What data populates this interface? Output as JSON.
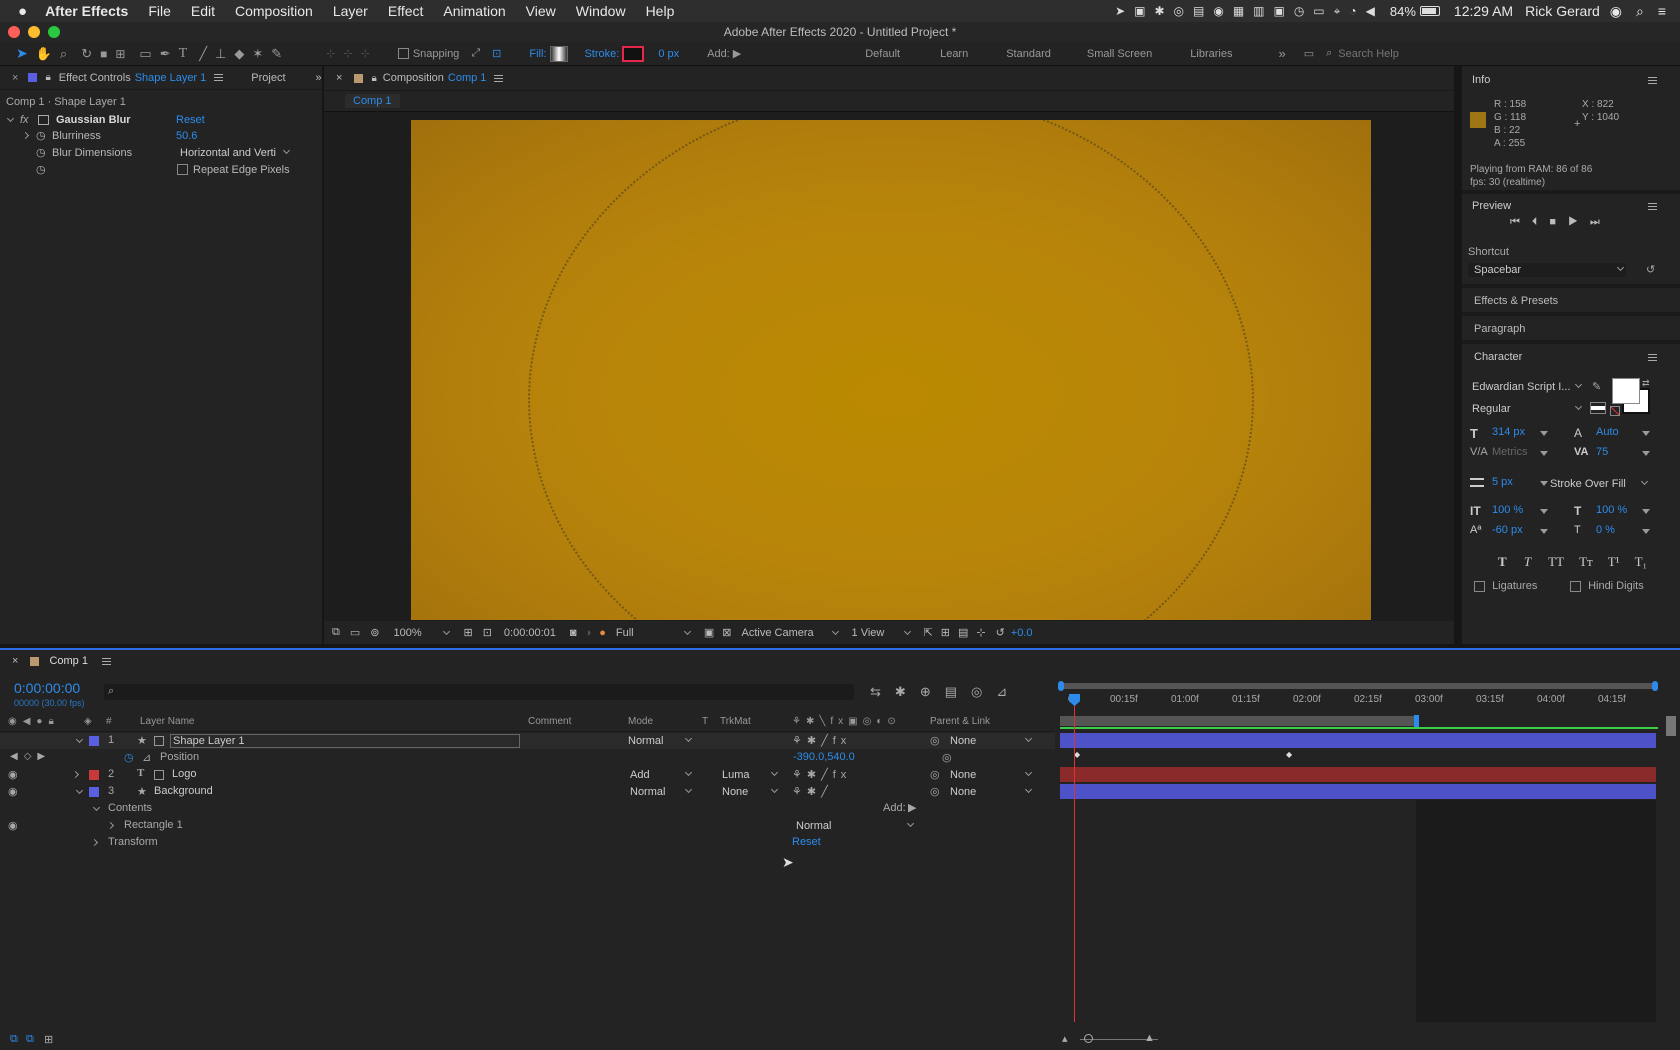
{
  "menubar": {
    "app": "After Effects",
    "items": [
      "File",
      "Edit",
      "Composition",
      "Layer",
      "Effect",
      "Animation",
      "View",
      "Window",
      "Help"
    ],
    "battery": "84%",
    "time": "12:29 AM",
    "user": "Rick Gerard"
  },
  "titlebar": {
    "title": "Adobe After Effects 2020 - Untitled Project *"
  },
  "toolbar": {
    "snapping": "Snapping",
    "fill": "Fill:",
    "stroke": "Stroke:",
    "stroke_px": "0 px",
    "add": "Add:",
    "workspaces": [
      "Default",
      "Learn",
      "Standard",
      "Small Screen",
      "Libraries"
    ],
    "search_placeholder": "Search Help"
  },
  "effect_controls": {
    "tab_prefix": "Effect Controls",
    "tab_layer": "Shape Layer 1",
    "project_tab": "Project",
    "breadcrumb": "Comp 1 · Shape Layer 1",
    "effect_name": "Gaussian Blur",
    "reset": "Reset",
    "blurriness_label": "Blurriness",
    "blurriness_value": "50.6",
    "dimensions_label": "Blur Dimensions",
    "dimensions_value": "Horizontal and Verti",
    "repeat_edge": "Repeat Edge Pixels"
  },
  "composition": {
    "tab_prefix": "Composition",
    "tab_comp": "Comp 1",
    "breadcrumb_comp": "Comp 1",
    "canvas_color": "#B8820E",
    "zoom": "100%",
    "timecode": "0:00:00:01",
    "resolution": "Full",
    "camera": "Active Camera",
    "views": "1 View",
    "exposure": "+0.0"
  },
  "info": {
    "title": "Info",
    "r": "R : 158",
    "g": "G : 118",
    "b": "B : 22",
    "a": "A : 255",
    "x": "X : 822",
    "y": "Y : 1040",
    "playing": "Playing from RAM: 86 of 86",
    "fps": "fps: 30 (realtime)",
    "swatch_color": "#9E7616"
  },
  "preview": {
    "title": "Preview",
    "shortcut_label": "Shortcut",
    "shortcut_value": "Spacebar"
  },
  "effects_presets": "Effects & Presets",
  "paragraph": "Paragraph",
  "character": {
    "title": "Character",
    "font": "Edwardian Script I...",
    "style": "Regular",
    "size": "314 px",
    "leading": "Auto",
    "kerning": "Metrics",
    "tracking": "75",
    "stroke_width": "5 px",
    "stroke_mode": "Stroke Over Fill",
    "vscale": "100 %",
    "hscale": "100 %",
    "baseline": "-60 px",
    "tsume": "0 %",
    "ligatures": "Ligatures",
    "hindi_digits": "Hindi Digits",
    "style_buttons": [
      "T",
      "T",
      "TT",
      "Tᴛ",
      "T¹",
      "T₁"
    ]
  },
  "timeline": {
    "tab": "Comp 1",
    "timecode": "0:00:00:00",
    "frames": "00000 (30.00 fps)",
    "headers": {
      "layer_name": "Layer Name",
      "comment": "Comment",
      "mode": "Mode",
      "t": "T",
      "trkmat": "TrkMat",
      "parent": "Parent & Link",
      "num": "#"
    },
    "ruler": [
      "0f",
      "00:15f",
      "01:00f",
      "01:15f",
      "02:00f",
      "02:15f",
      "03:00f",
      "03:15f",
      "04:00f",
      "04:15f"
    ],
    "layers": [
      {
        "num": "1",
        "name": "Shape Layer 1",
        "mode": "Normal",
        "trkmat": "",
        "parent": "None",
        "color": "#5a5ee0"
      },
      {
        "num": "2",
        "name": "Logo",
        "mode": "Add",
        "trkmat": "Luma",
        "parent": "None",
        "color": "#c83a3a"
      },
      {
        "num": "3",
        "name": "Background",
        "mode": "Normal",
        "trkmat": "None",
        "parent": "None",
        "color": "#5a5ee0"
      }
    ],
    "position_label": "Position",
    "position_value": "-390.0,540.0",
    "contents": "Contents",
    "add": "Add:",
    "rectangle": "Rectangle 1",
    "rect_mode": "Normal",
    "transform": "Transform",
    "reset": "Reset"
  }
}
